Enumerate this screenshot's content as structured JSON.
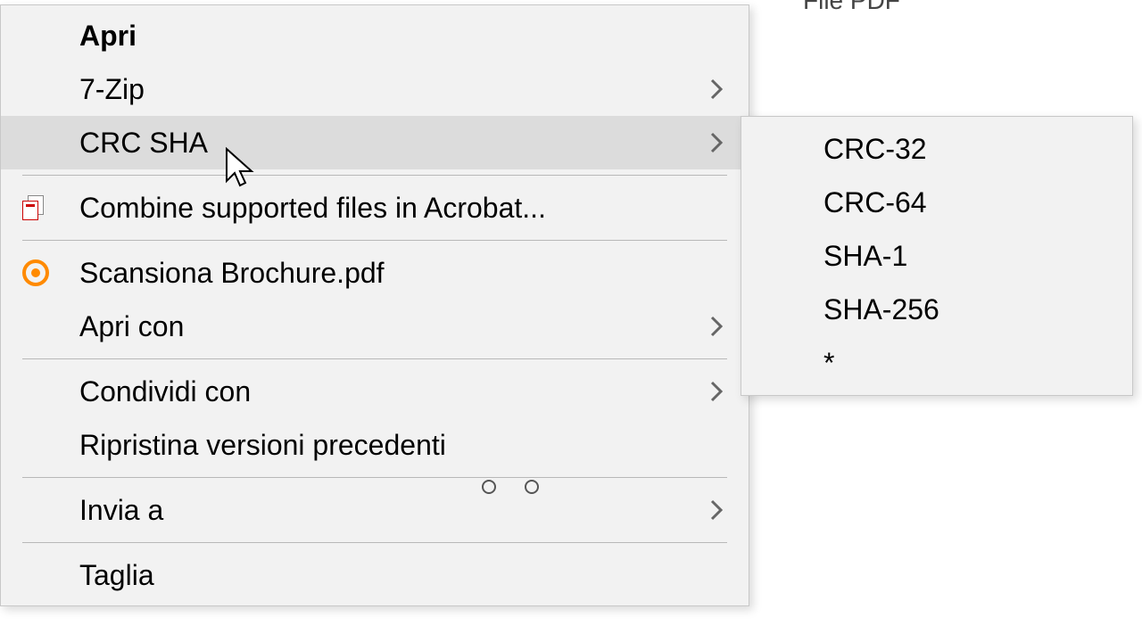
{
  "background": {
    "file_type_label": "File PDF"
  },
  "context_menu": {
    "items": [
      {
        "label": "Apri",
        "bold": true,
        "has_submenu": false,
        "separator_after": false,
        "icon": null
      },
      {
        "label": "7-Zip",
        "bold": false,
        "has_submenu": true,
        "separator_after": false,
        "icon": null
      },
      {
        "label": "CRC SHA",
        "bold": false,
        "has_submenu": true,
        "separator_after": true,
        "icon": null,
        "hovered": true
      },
      {
        "label": "Combine supported files in Acrobat...",
        "bold": false,
        "has_submenu": false,
        "separator_after": true,
        "icon": "acrobat"
      },
      {
        "label": "Scansiona Brochure.pdf",
        "bold": false,
        "has_submenu": false,
        "separator_after": false,
        "icon": "avast"
      },
      {
        "label": "Apri con",
        "bold": false,
        "has_submenu": true,
        "separator_after": true,
        "icon": null
      },
      {
        "label": "Condividi con",
        "bold": false,
        "has_submenu": true,
        "separator_after": false,
        "icon": null
      },
      {
        "label": "Ripristina versioni precedenti",
        "bold": false,
        "has_submenu": false,
        "separator_after": true,
        "icon": null
      },
      {
        "label": "Invia a",
        "bold": false,
        "has_submenu": true,
        "separator_after": true,
        "icon": null
      },
      {
        "label": "Taglia",
        "bold": false,
        "has_submenu": false,
        "separator_after": false,
        "icon": null
      }
    ]
  },
  "submenu": {
    "items": [
      {
        "label": "CRC-32"
      },
      {
        "label": "CRC-64"
      },
      {
        "label": "SHA-1"
      },
      {
        "label": "SHA-256"
      },
      {
        "label": "*"
      }
    ]
  }
}
